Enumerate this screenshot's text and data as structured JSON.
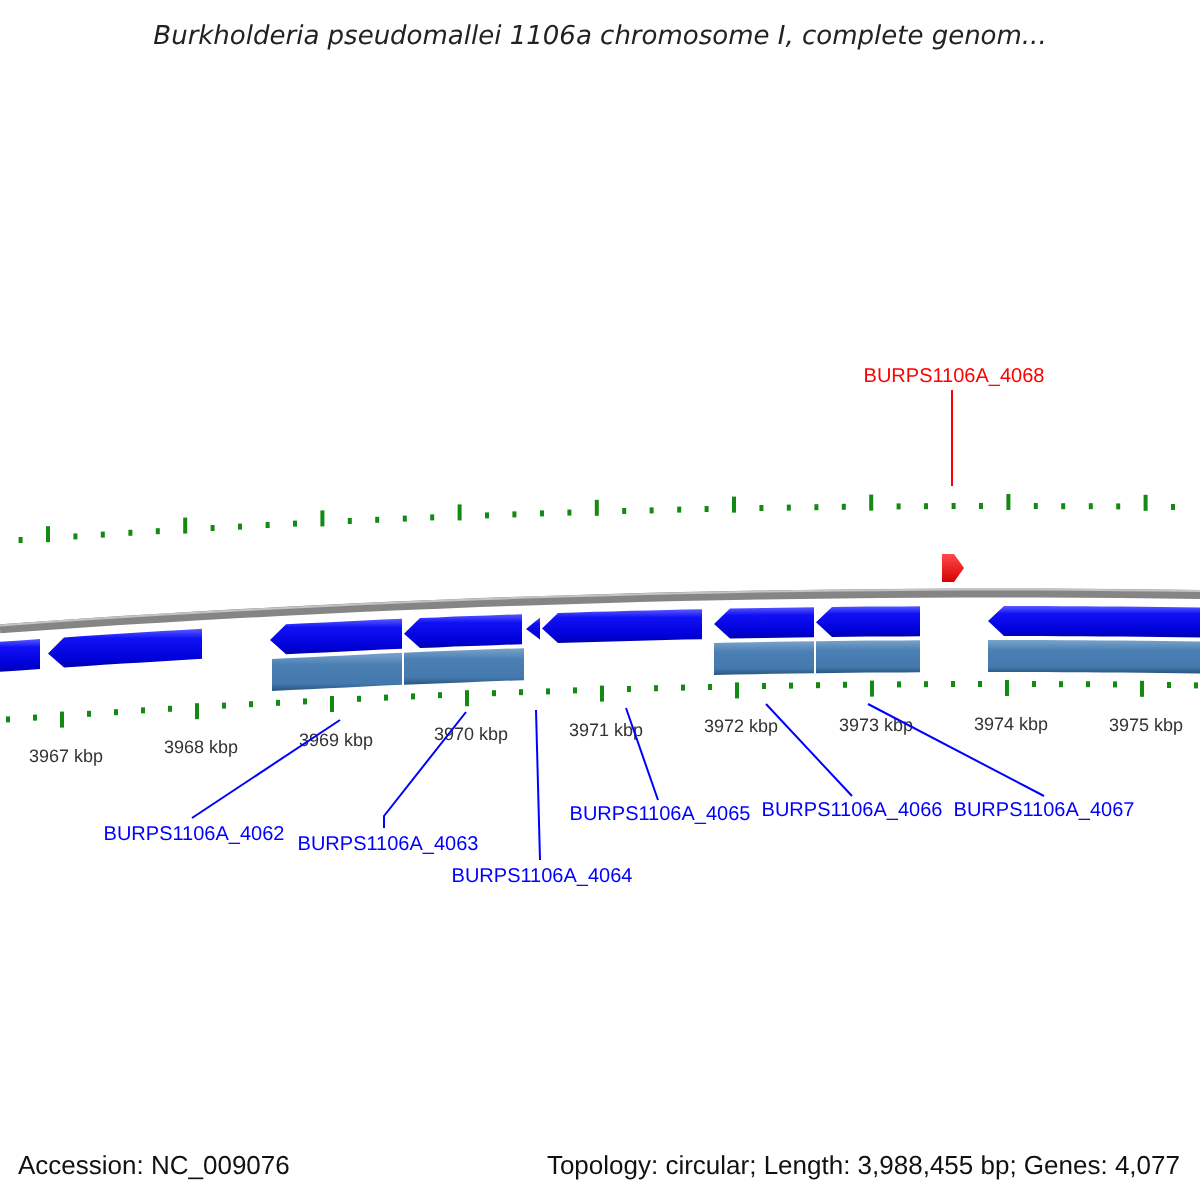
{
  "title": "Burkholderia pseudomallei 1106a chromosome I, complete genom...",
  "map": {
    "scale_labels": [
      "3967 kbp",
      "3968 kbp",
      "3969 kbp",
      "3970 kbp",
      "3971 kbp",
      "3972 kbp",
      "3973 kbp",
      "3974 kbp",
      "3975 kbp"
    ],
    "genes": [
      {
        "label": "BURPS1106A_4062",
        "selected": false
      },
      {
        "label": "BURPS1106A_4063",
        "selected": false
      },
      {
        "label": "BURPS1106A_4064",
        "selected": false
      },
      {
        "label": "BURPS1106A_4065",
        "selected": false
      },
      {
        "label": "BURPS1106A_4066",
        "selected": false
      },
      {
        "label": "BURPS1106A_4067",
        "selected": false
      },
      {
        "label": "BURPS1106A_4068",
        "selected": true
      }
    ]
  },
  "footer": {
    "accession": "Accession: NC_009076",
    "summary": "Topology: circular; Length: 3,988,455 bp; Genes: 4,077"
  }
}
